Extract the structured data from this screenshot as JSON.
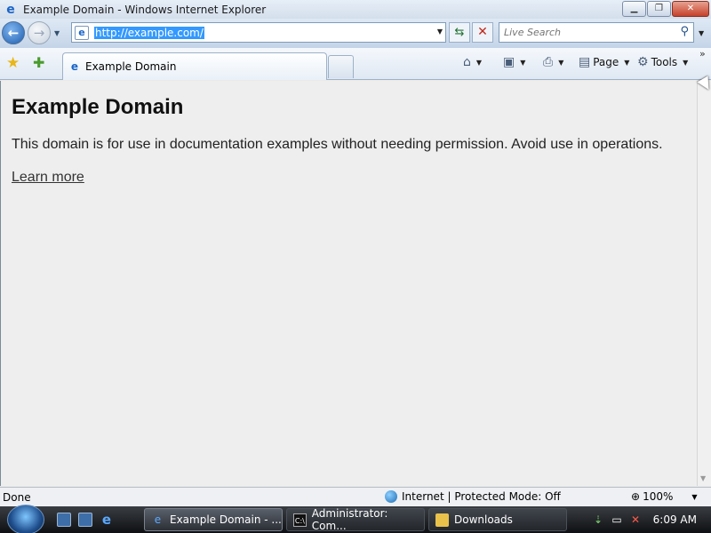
{
  "window": {
    "title": "Example Domain - Windows Internet Explorer",
    "icons": {
      "app": "ie-icon",
      "minimize": "minimize-icon",
      "maximize": "maximize-icon",
      "close": "close-icon"
    }
  },
  "navigation": {
    "address_url": "http://example.com/",
    "search_placeholder": "Live Search"
  },
  "tabs": [
    {
      "label": "Example Domain",
      "active": true
    }
  ],
  "commands": {
    "page_label": "Page",
    "tools_label": "Tools"
  },
  "content": {
    "heading": "Example Domain",
    "description": "This domain is for use in documentation examples without needing permission. Avoid use in operations.",
    "link_text": "Learn more"
  },
  "statusbar": {
    "status": "Done",
    "zone": "Internet | Protected Mode: Off",
    "zoom": "100%"
  },
  "taskbar": {
    "tasks": [
      {
        "label": "Example Domain - ...",
        "active": true
      },
      {
        "label": "Administrator: Com...",
        "active": false
      },
      {
        "label": "Downloads",
        "active": false
      }
    ],
    "clock": "6:09 AM"
  },
  "colors": {
    "accent": "#1b65c8",
    "selection": "#3399ff",
    "taskbar": "#1c1f23"
  }
}
